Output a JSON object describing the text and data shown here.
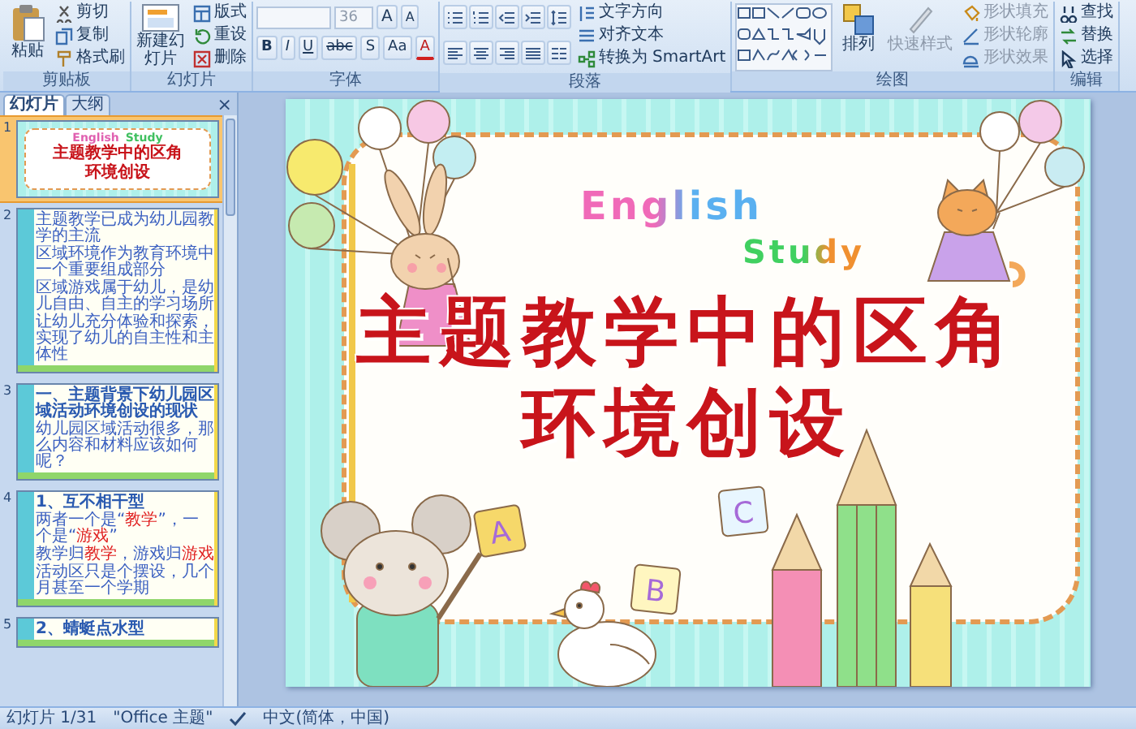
{
  "ribbon": {
    "groups": [
      {
        "kind": "clipboard",
        "label": "剪贴板",
        "big": {
          "label": "粘贴"
        },
        "items": [
          {
            "label": "剪切"
          },
          {
            "label": "复制"
          },
          {
            "label": "格式刷"
          }
        ]
      },
      {
        "kind": "slides",
        "label": "幻灯片",
        "big": {
          "label": "新建幻灯片"
        },
        "items": [
          {
            "label": "版式"
          },
          {
            "label": "重设"
          },
          {
            "label": "删除"
          }
        ]
      },
      {
        "kind": "font",
        "label": "字体",
        "font_size": "36",
        "grow": "A",
        "shrink": "A",
        "format": [
          "B",
          "I",
          "U",
          "abc",
          "S",
          "Aa",
          "A"
        ]
      },
      {
        "kind": "paragraph",
        "label": "段落",
        "items": [
          {
            "label": "文字方向"
          },
          {
            "label": "对齐文本"
          },
          {
            "label": "转换为 SmartArt"
          }
        ]
      },
      {
        "kind": "drawing",
        "label": "绘图",
        "arrange": {
          "label": "排列",
          "disabled": false
        },
        "quick_styles": {
          "label": "快速样式",
          "disabled": true
        },
        "items": [
          {
            "label": "形状填充",
            "disabled": true
          },
          {
            "label": "形状轮廓",
            "disabled": true
          },
          {
            "label": "形状效果",
            "disabled": true
          }
        ]
      },
      {
        "kind": "editing",
        "label": "编辑",
        "items": [
          {
            "label": "查找"
          },
          {
            "label": "替换"
          },
          {
            "label": "选择"
          }
        ]
      }
    ]
  },
  "panel": {
    "tabs": [
      {
        "label": "幻灯片",
        "selected": true
      },
      {
        "label": "大纲",
        "selected": false
      }
    ],
    "close": "×",
    "slides": [
      {
        "number": "1",
        "kind": "cover",
        "selected": true,
        "english": "English",
        "study": "Study",
        "title_lines": [
          "主题教学中的区角",
          "环境创设"
        ]
      },
      {
        "number": "2",
        "kind": "text",
        "selected": false,
        "lines": [
          "主题教学已成为幼儿园教学的主流",
          "区域环境作为教育环境中一个重要组成部分",
          "区域游戏属于幼儿，是幼儿自由、自主的学习场所",
          "让幼儿充分体验和探索，实现了幼儿的自主性和主体性"
        ]
      },
      {
        "number": "3",
        "kind": "text",
        "selected": false,
        "title": "一、主题背景下幼儿园区域活动环境创设的现状",
        "lines": [
          "幼儿园区域活动很多，那么内容和材料应该如何呢？"
        ]
      },
      {
        "number": "4",
        "kind": "text",
        "selected": false,
        "title": "1、互不相干型",
        "lines": [
          "两者一个是“**教学**”，一个是“**游戏**”",
          "教学归**教学**，游戏归**游戏**",
          "活动区只是个摆设，几个月甚至一个学期"
        ]
      },
      {
        "number": "5",
        "kind": "text",
        "selected": false,
        "title": "2、蜻蜓点水型"
      }
    ]
  },
  "slide": {
    "english": "English",
    "study": "Study",
    "title_lines": [
      "主题教学中的区角",
      "环境创设"
    ],
    "blocks": [
      "A",
      "B",
      "C"
    ]
  },
  "status_bar": {
    "slide_info": "幻灯片 1/31",
    "theme": "\"Office 主题\"",
    "language": "中文(简体，中国)"
  }
}
